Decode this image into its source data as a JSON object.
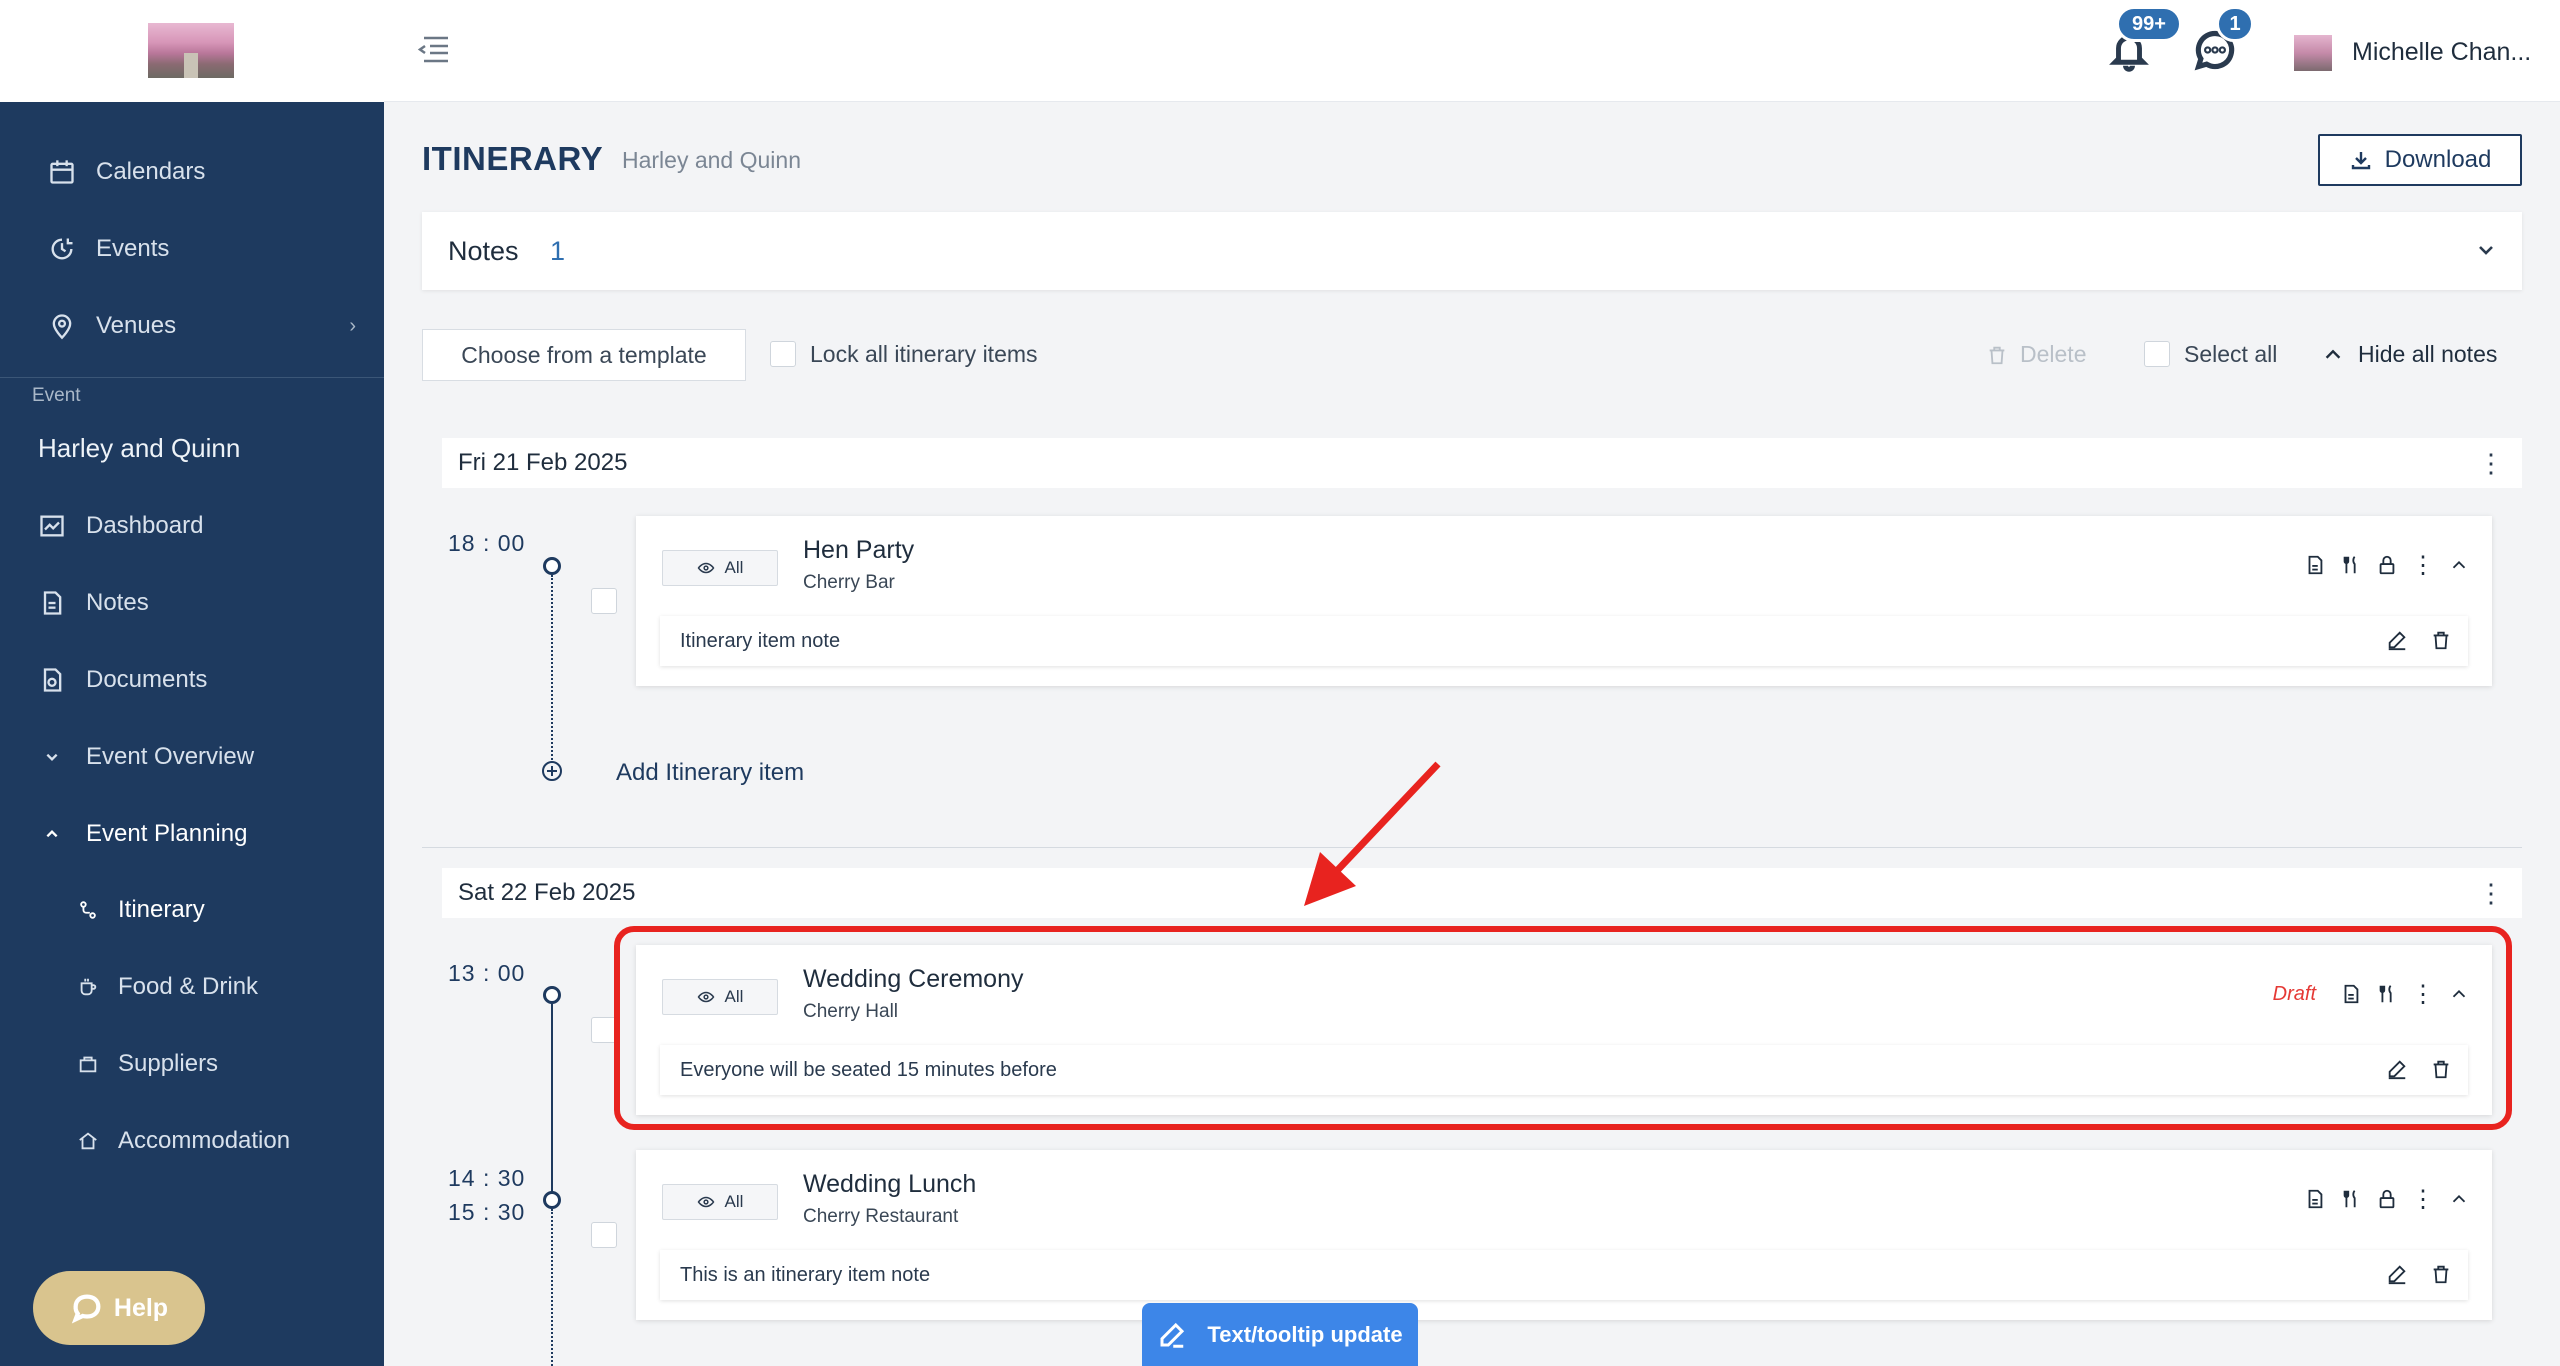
{
  "sidebar": {
    "nav": [
      {
        "label": "Calendars",
        "icon": "calendar-icon"
      },
      {
        "label": "Events",
        "icon": "events-icon"
      },
      {
        "label": "Venues",
        "icon": "location-pin-icon"
      }
    ],
    "event_label": "Event",
    "event_name": "Harley and Quinn",
    "event_nav": [
      {
        "label": "Dashboard",
        "icon": "dashboard-icon"
      },
      {
        "label": "Notes",
        "icon": "note-icon"
      },
      {
        "label": "Documents",
        "icon": "documents-icon"
      },
      {
        "label": "Event Overview",
        "icon": "chevron-down-icon"
      },
      {
        "label": "Event Planning",
        "icon": "chevron-up-icon"
      }
    ],
    "planning_sub": [
      {
        "label": "Itinerary",
        "icon": "itinerary-icon",
        "active": true
      },
      {
        "label": "Food & Drink",
        "icon": "cup-icon"
      },
      {
        "label": "Suppliers",
        "icon": "suppliers-icon"
      },
      {
        "label": "Accommodation",
        "icon": "home-icon"
      }
    ],
    "help_label": "Help"
  },
  "topbar": {
    "notifications_badge": "99+",
    "messages_badge": "1",
    "user_name": "Michelle Chan..."
  },
  "page": {
    "title": "ITINERARY",
    "subtitle": "Harley and Quinn",
    "download_label": "Download"
  },
  "notes_panel": {
    "title": "Notes",
    "count": "1"
  },
  "toolbar": {
    "template_label": "Choose from a template",
    "lock_label": "Lock all itinerary items",
    "delete_label": "Delete",
    "select_all_label": "Select all",
    "hide_notes_label": "Hide all notes"
  },
  "days": [
    {
      "date": "Fri 21 Feb 2025",
      "items": [
        {
          "time": "18 : 00",
          "visibility": "All",
          "title": "Hen Party",
          "venue": "Cherry Bar",
          "note": "Itinerary item note",
          "status": ""
        }
      ],
      "add_label": "Add Itinerary item"
    },
    {
      "date": "Sat 22 Feb 2025",
      "items": [
        {
          "time": "13 : 00",
          "visibility": "All",
          "title": "Wedding Ceremony",
          "venue": "Cherry Hall",
          "note": "Everyone will be seated 15 minutes before",
          "status": "Draft"
        },
        {
          "time": "14 : 30",
          "time_end": "15 : 30",
          "visibility": "All",
          "title": "Wedding Lunch",
          "venue": "Cherry Restaurant",
          "note": "This is an itinerary item note",
          "status": ""
        }
      ]
    }
  ],
  "feedback_button": "Text/tooltip update",
  "colors": {
    "sidebar_bg": "#1e3a5f",
    "accent": "#2f6fb0",
    "highlight": "#e8231f",
    "draft": "#e53935",
    "help": "#d9c48e",
    "feedback": "#3d86e8"
  }
}
